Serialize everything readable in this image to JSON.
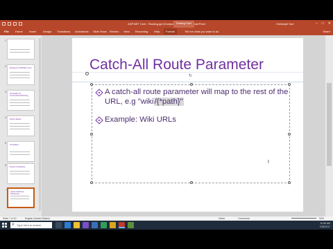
{
  "window": {
    "title": "ASP.NET Core - Routing.ppt [Compatibility Mode] - PowerPoint",
    "contextual_tab": "Drawing Tools",
    "user": "Christoph Surr"
  },
  "ribbon": {
    "tabs": [
      "File",
      "Home",
      "Insert",
      "Design",
      "Transitions",
      "Animations",
      "Slide Show",
      "Review",
      "View",
      "Recording",
      "Help",
      "Format"
    ],
    "tell_me": "Tell me what you want to do",
    "share": "Share"
  },
  "slide": {
    "title": "Catch-All Route Parameter",
    "bullets": [
      {
        "text_before": "A catch-all route parameter will map to the rest of the URL, e.g \"wiki",
        "text_highlighted": "/{*path}\""
      },
      {
        "text_before": "Example: Wiki URLs",
        "text_highlighted": ""
      }
    ]
  },
  "thumbnails": [
    {
      "number": "1",
      "title": ""
    },
    {
      "number": "2",
      "title": "Routing in ASP.NET Core"
    },
    {
      "number": "3",
      "title": "IP Header for Conventional Routing"
    },
    {
      "number": "4",
      "title": "Route Values"
    },
    {
      "number": "5",
      "title": "Templates"
    },
    {
      "number": "6",
      "title": "Route Constraints"
    },
    {
      "number": "7",
      "title": "Catch-All Route Parameter"
    }
  ],
  "status": {
    "slide_label": "Slide 7 of 10",
    "language": "English (United States)",
    "notes": "Notes",
    "comments": "Comments",
    "zoom": "93%"
  },
  "taskbar": {
    "search_placeholder": "Type here to search",
    "time": "10:56 AM",
    "date": "7/28/2017"
  },
  "colors": {
    "accent": "#b7472a",
    "title_text": "#7030a0",
    "body_text": "#4b2d6e"
  }
}
